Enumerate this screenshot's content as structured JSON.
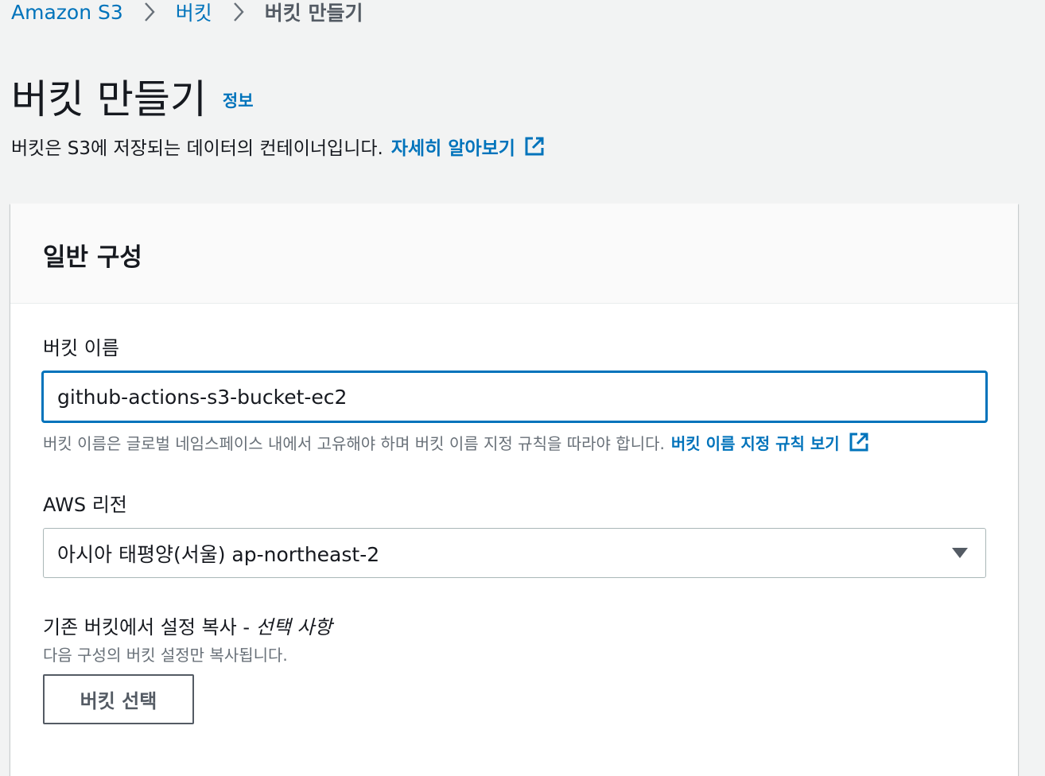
{
  "breadcrumb": {
    "items": [
      {
        "label": "Amazon S3"
      },
      {
        "label": "버킷"
      },
      {
        "label": "버킷 만들기"
      }
    ]
  },
  "header": {
    "title": "버킷 만들기",
    "info_link": "정보",
    "description": "버킷은 S3에 저장되는 데이터의 컨테이너입니다.",
    "learn_more_link": "자세히 알아보기"
  },
  "general_config": {
    "section_title": "일반 구성",
    "bucket_name": {
      "label": "버킷 이름",
      "value": "github-actions-s3-bucket-ec2",
      "constraint": "버킷 이름은 글로벌 네임스페이스 내에서 고유해야 하며 버킷 이름 지정 규칙을 따라야 합니다.",
      "rules_link": "버킷 이름 지정 규칙 보기"
    },
    "region": {
      "label": "AWS 리전",
      "selected": "아시아 태평양(서울) ap-northeast-2"
    },
    "copy_settings": {
      "label": "기존 버킷에서 설정 복사 - ",
      "optional": "선택 사항",
      "description": "다음 구성의 버킷 설정만 복사됩니다.",
      "button_label": "버킷 선택"
    }
  },
  "icons": {
    "breadcrumb_separator": "chevron-right-icon",
    "external_link": "external-link-icon",
    "dropdown": "caret-down-icon"
  },
  "colors": {
    "link": "#0073bb",
    "page_background": "#f2f3f3",
    "focus_border": "#0073bb",
    "secondary_text": "#687078"
  }
}
